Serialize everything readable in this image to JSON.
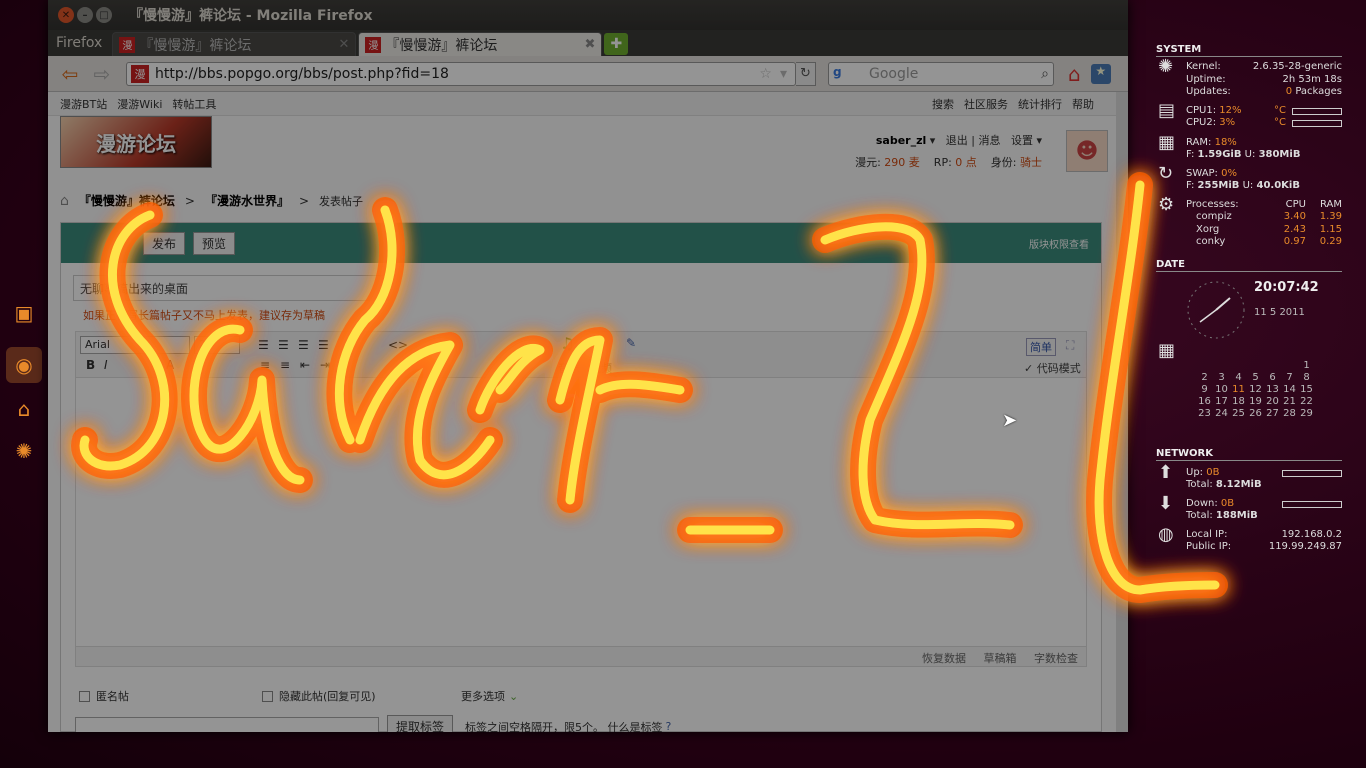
{
  "window": {
    "title": "『慢慢游』裤论坛 - Mozilla Firefox",
    "firefox_menu": "Firefox"
  },
  "tabs": [
    {
      "label": "『慢慢游』裤论坛",
      "fav": "漫"
    },
    {
      "label": "『慢慢游』裤论坛",
      "fav": "漫"
    }
  ],
  "nav": {
    "url": "http://bbs.popgo.org/bbs/post.php?fid=18",
    "search_placeholder": "Google"
  },
  "site_nav": {
    "left": [
      "漫游BT站",
      "漫游Wiki",
      "转帖工具"
    ],
    "right": [
      "搜索",
      "社区服务",
      "统计排行",
      "帮助"
    ]
  },
  "header": {
    "logo_text": "漫游论坛",
    "username": "saber_zl",
    "logout": "退出",
    "messages": "消息",
    "settings": "设置",
    "coin_label": "漫元:",
    "coin_value": "290 麦",
    "rp_label": "RP:",
    "rp_value": "0 点",
    "rank_label": "身份:",
    "rank_value": "骑士"
  },
  "breadcrumbs": {
    "forum": "『慢慢游』裤论坛",
    "board": "『漫游水世界』",
    "current": "发表帖子"
  },
  "editor": {
    "publish": "发布",
    "preview": "预览",
    "permissions": "版块权限查看",
    "subject": "无聊事搞出来的桌面",
    "tip": "如果正在写长篇帖子又不马上发表，建议存为草稿",
    "font": "Arial",
    "size": "2",
    "simple": "简单",
    "code_mode": "代码模式",
    "music": "音乐",
    "video": "视频",
    "footer": [
      "恢复数据",
      "草稿箱",
      "字数检查"
    ],
    "anonymous": "匿名帖",
    "hide": "隐藏此帖(回复可见)",
    "more_options": "更多选项",
    "tag_button": "提取标签",
    "tag_hint": "标签之间空格隔开，限5个。 什么是标签"
  },
  "conky": {
    "system_title": "SYSTEM",
    "kernel_label": "Kernel:",
    "kernel": "2.6.35-28-generic",
    "uptime_label": "Uptime:",
    "uptime": "2h 53m 18s",
    "updates_label": "Updates:",
    "updates_num": "0",
    "updates_text": "Packages",
    "cpu1_label": "CPU1:",
    "cpu1": "12%",
    "cpu2_label": "CPU2:",
    "cpu2": "3%",
    "temp_unit": "°C",
    "ram_label": "RAM:",
    "ram": "18%",
    "ram_free_label": "F:",
    "ram_free": "1.59GiB",
    "ram_used_label": "U:",
    "ram_used": "380MiB",
    "swap_label": "SWAP:",
    "swap": "0%",
    "swap_free_label": "F:",
    "swap_free": "255MiB",
    "swap_used_label": "U:",
    "swap_used": "40.0KiB",
    "proc_label": "Processes:",
    "cpu_col": "CPU",
    "ram_col": "RAM",
    "procs": [
      {
        "name": "compiz",
        "cpu": "3.40",
        "ram": "1.39"
      },
      {
        "name": "Xorg",
        "cpu": "2.43",
        "ram": "1.15"
      },
      {
        "name": "conky",
        "cpu": "0.97",
        "ram": "0.29"
      }
    ],
    "date_title": "DATE",
    "time": "20:07:42",
    "date_line": "11  5  2011",
    "calendar": [
      [
        "",
        "",
        "",
        "",
        "",
        "",
        "1"
      ],
      [
        "2",
        "3",
        "4",
        "5",
        "6",
        "7",
        "8"
      ],
      [
        "9",
        "10",
        "11",
        "12",
        "13",
        "14",
        "15"
      ],
      [
        "16",
        "17",
        "18",
        "19",
        "20",
        "21",
        "22"
      ],
      [
        "23",
        "24",
        "25",
        "26",
        "27",
        "28",
        "29"
      ]
    ],
    "network_title": "NETWORK",
    "up_label": "Up:",
    "up": "0B",
    "up_total_label": "Total:",
    "up_total": "8.12MiB",
    "down_label": "Down:",
    "down": "0B",
    "down_total_label": "Total:",
    "down_total": "188MiB",
    "local_ip_label": "Local IP:",
    "local_ip": "192.168.0.2",
    "public_ip_label": "Public IP:",
    "public_ip": "119.99.249.87"
  },
  "colors": {
    "accent": "#e88a2a",
    "editor_header": "#3c8c7c",
    "scribble": "#ffcc00"
  }
}
